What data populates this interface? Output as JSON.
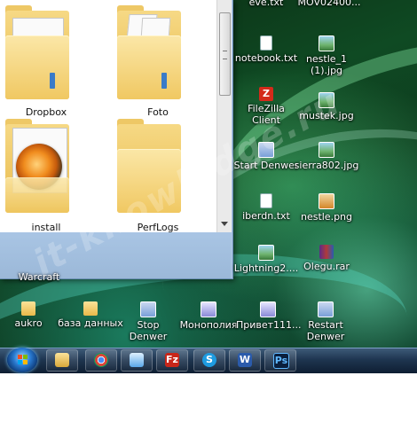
{
  "explorer": {
    "folders": [
      {
        "label": "Dropbox",
        "icon": "folder-icon"
      },
      {
        "label": "Foto",
        "icon": "folder-icon"
      },
      {
        "label": "install",
        "icon": "folder-with-cd-icon"
      },
      {
        "label": "PerfLogs",
        "icon": "folder-icon"
      }
    ]
  },
  "desktop_icons": {
    "partial_label": "Warcraft",
    "right_col1": [
      {
        "label": "eve.txt",
        "icon": "text-file-icon"
      },
      {
        "label": "notebook.txt",
        "icon": "text-file-icon"
      },
      {
        "label": "FileZilla Client",
        "icon": "filezilla-icon"
      },
      {
        "label": "Start Denwer",
        "icon": "denwer-icon"
      },
      {
        "label": "iberdn.txt",
        "icon": "text-file-icon"
      },
      {
        "label": "Lightning2....",
        "icon": "image-file-icon"
      }
    ],
    "right_col2": [
      {
        "label": "MOV02400...",
        "icon": "video-file-icon"
      },
      {
        "label": "nestle_1 (1).jpg",
        "icon": "image-file-icon"
      },
      {
        "label": "mustek.jpg",
        "icon": "image-file-icon"
      },
      {
        "label": "sierra802.jpg",
        "icon": "image-file-icon"
      },
      {
        "label": "nestle.png",
        "icon": "image-file-icon"
      },
      {
        "label": "Olegu.rar",
        "icon": "rar-archive-icon"
      }
    ],
    "bottom_row": [
      {
        "label": "aukro",
        "icon": "folder-icon"
      },
      {
        "label": "база данных",
        "icon": "folder-icon"
      },
      {
        "label": "Stop Denwer",
        "icon": "denwer-icon"
      },
      {
        "label": "Монополия",
        "icon": "game-icon"
      },
      {
        "label": "Привет111...",
        "icon": "word-document-icon"
      },
      {
        "label": "Restart Denwer",
        "icon": "denwer-icon"
      }
    ]
  },
  "taskbar": {
    "start_icon": "windows-start-orb-icon",
    "pinned": [
      {
        "icon": "explorer-folder-icon",
        "glyph": ""
      },
      {
        "icon": "chrome-icon",
        "glyph": ""
      },
      {
        "icon": "network-icon",
        "glyph": ""
      },
      {
        "icon": "filezilla-icon",
        "glyph": "Fz"
      },
      {
        "icon": "skype-icon",
        "glyph": "S"
      },
      {
        "icon": "word-icon",
        "glyph": "W"
      },
      {
        "icon": "photoshop-icon",
        "glyph": "Ps"
      }
    ]
  },
  "watermark": "it-knowledge.ru",
  "colors": {
    "taskbar": "#1e3550",
    "desktop_green": "#0f4a23",
    "folder_yellow": "#f0c862"
  }
}
